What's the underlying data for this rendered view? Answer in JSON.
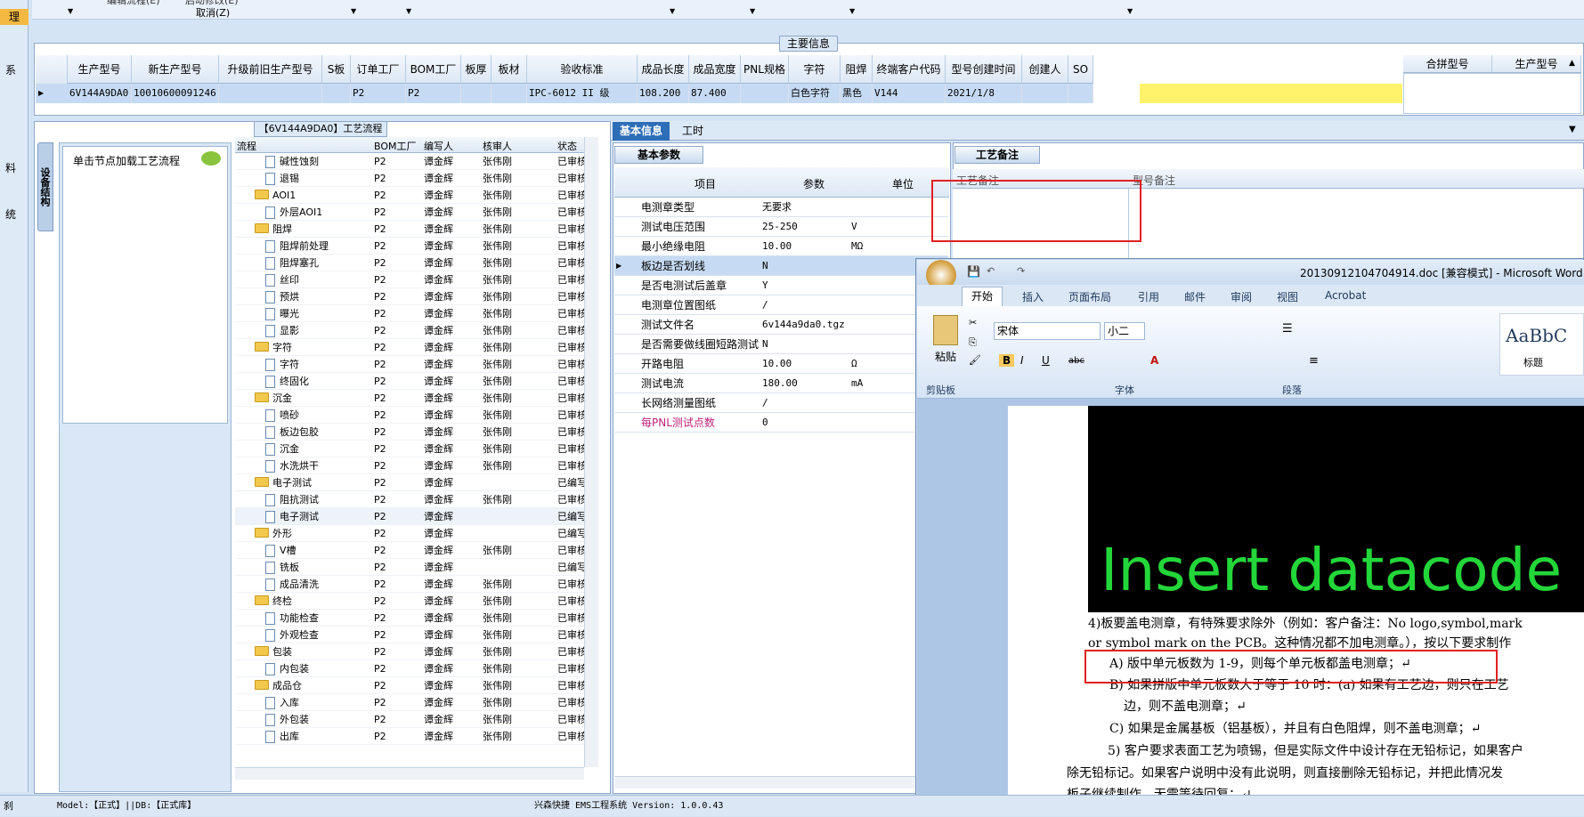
{
  "topbar": {
    "item1": "编辑流程(E)",
    "item2": "启动修改(E)",
    "cancel": "取消(Z)",
    "left_sel": "理"
  },
  "left_strip": {
    "chars": [
      "系",
      "料",
      "统"
    ]
  },
  "main_info": {
    "legend": "主要信息",
    "columns": [
      "生产型号",
      "新生产型号",
      "升级前旧生产型号",
      "S板",
      "订单工厂",
      "BOM工厂",
      "板厚",
      "板材",
      "验收标准",
      "成品长度",
      "成品宽度",
      "PNL规格",
      "字符",
      "阻焊",
      "终端客户代码",
      "型号创建时间",
      "创建人",
      "SO"
    ],
    "row": [
      "6V144A9DA0",
      "10010600091246",
      "",
      "",
      "P2",
      "P2",
      "",
      "",
      "IPC-6012 II 级",
      "108.200",
      "87.400",
      "",
      "白色字符",
      "黑色",
      "V144",
      "2021/1/8",
      "",
      ""
    ],
    "right_columns": [
      "合拼型号",
      "生产型号"
    ]
  },
  "process": {
    "title": "【6V144A9DA0】工艺流程",
    "side_tab": "设备结构",
    "click_hint": "单击节点加载工艺流程",
    "columns": [
      "流程",
      "BOM工厂",
      "编写人",
      "核审人",
      "状态"
    ],
    "rows": [
      {
        "level": 2,
        "type": "doc",
        "name": "碱性蚀刻",
        "bom": "P2",
        "writer": "谭金辉",
        "reviewer": "张伟刚",
        "status": "已审核"
      },
      {
        "level": 2,
        "type": "doc",
        "name": "退锡",
        "bom": "P2",
        "writer": "谭金辉",
        "reviewer": "张伟刚",
        "status": "已审核"
      },
      {
        "level": 1,
        "type": "folder",
        "name": "AOI1",
        "bom": "P2",
        "writer": "谭金辉",
        "reviewer": "张伟刚",
        "status": "已审核"
      },
      {
        "level": 2,
        "type": "doc",
        "name": "外层AOI1",
        "bom": "P2",
        "writer": "谭金辉",
        "reviewer": "张伟刚",
        "status": "已审核"
      },
      {
        "level": 1,
        "type": "folder",
        "name": "阻焊",
        "bom": "P2",
        "writer": "谭金辉",
        "reviewer": "张伟刚",
        "status": "已审核"
      },
      {
        "level": 2,
        "type": "doc",
        "name": "阻焊前处理",
        "bom": "P2",
        "writer": "谭金辉",
        "reviewer": "张伟刚",
        "status": "已审核"
      },
      {
        "level": 2,
        "type": "doc",
        "name": "阻焊塞孔",
        "bom": "P2",
        "writer": "谭金辉",
        "reviewer": "张伟刚",
        "status": "已审核"
      },
      {
        "level": 2,
        "type": "doc",
        "name": "丝印",
        "bom": "P2",
        "writer": "谭金辉",
        "reviewer": "张伟刚",
        "status": "已审核"
      },
      {
        "level": 2,
        "type": "doc",
        "name": "预烘",
        "bom": "P2",
        "writer": "谭金辉",
        "reviewer": "张伟刚",
        "status": "已审核"
      },
      {
        "level": 2,
        "type": "doc",
        "name": "曝光",
        "bom": "P2",
        "writer": "谭金辉",
        "reviewer": "张伟刚",
        "status": "已审核"
      },
      {
        "level": 2,
        "type": "doc",
        "name": "显影",
        "bom": "P2",
        "writer": "谭金辉",
        "reviewer": "张伟刚",
        "status": "已审核"
      },
      {
        "level": 1,
        "type": "folder",
        "name": "字符",
        "bom": "P2",
        "writer": "谭金辉",
        "reviewer": "张伟刚",
        "status": "已审核"
      },
      {
        "level": 2,
        "type": "doc",
        "name": "字符",
        "bom": "P2",
        "writer": "谭金辉",
        "reviewer": "张伟刚",
        "status": "已审核"
      },
      {
        "level": 2,
        "type": "doc",
        "name": "终固化",
        "bom": "P2",
        "writer": "谭金辉",
        "reviewer": "张伟刚",
        "status": "已审核"
      },
      {
        "level": 1,
        "type": "folder",
        "name": "沉金",
        "bom": "P2",
        "writer": "谭金辉",
        "reviewer": "张伟刚",
        "status": "已审核"
      },
      {
        "level": 2,
        "type": "doc",
        "name": "喷砂",
        "bom": "P2",
        "writer": "谭金辉",
        "reviewer": "张伟刚",
        "status": "已审核"
      },
      {
        "level": 2,
        "type": "doc",
        "name": "板边包胶",
        "bom": "P2",
        "writer": "谭金辉",
        "reviewer": "张伟刚",
        "status": "已审核"
      },
      {
        "level": 2,
        "type": "doc",
        "name": "沉金",
        "bom": "P2",
        "writer": "谭金辉",
        "reviewer": "张伟刚",
        "status": "已审核"
      },
      {
        "level": 2,
        "type": "doc",
        "name": "水洗烘干",
        "bom": "P2",
        "writer": "谭金辉",
        "reviewer": "张伟刚",
        "status": "已审核"
      },
      {
        "level": 1,
        "type": "folder",
        "name": "电子测试",
        "bom": "P2",
        "writer": "谭金辉",
        "reviewer": "",
        "status": "已编写"
      },
      {
        "level": 2,
        "type": "doc",
        "name": "阻抗测试",
        "bom": "P2",
        "writer": "谭金辉",
        "reviewer": "张伟刚",
        "status": "已审核"
      },
      {
        "level": 2,
        "type": "doc",
        "name": "电子测试",
        "bom": "P2",
        "writer": "谭金辉",
        "reviewer": "",
        "status": "已编写",
        "selected": true
      },
      {
        "level": 1,
        "type": "folder",
        "name": "外形",
        "bom": "P2",
        "writer": "谭金辉",
        "reviewer": "",
        "status": "已编写"
      },
      {
        "level": 2,
        "type": "doc",
        "name": "V槽",
        "bom": "P2",
        "writer": "谭金辉",
        "reviewer": "张伟刚",
        "status": "已审核"
      },
      {
        "level": 2,
        "type": "doc",
        "name": "铣板",
        "bom": "P2",
        "writer": "谭金辉",
        "reviewer": "",
        "status": "已编写"
      },
      {
        "level": 2,
        "type": "doc",
        "name": "成品清洗",
        "bom": "P2",
        "writer": "谭金辉",
        "reviewer": "张伟刚",
        "status": "已审核"
      },
      {
        "level": 1,
        "type": "folder",
        "name": "终检",
        "bom": "P2",
        "writer": "谭金辉",
        "reviewer": "张伟刚",
        "status": "已审核"
      },
      {
        "level": 2,
        "type": "doc",
        "name": "功能检查",
        "bom": "P2",
        "writer": "谭金辉",
        "reviewer": "张伟刚",
        "status": "已审核"
      },
      {
        "level": 2,
        "type": "doc",
        "name": "外观检查",
        "bom": "P2",
        "writer": "谭金辉",
        "reviewer": "张伟刚",
        "status": "已审核"
      },
      {
        "level": 1,
        "type": "folder",
        "name": "包装",
        "bom": "P2",
        "writer": "谭金辉",
        "reviewer": "张伟刚",
        "status": "已审核"
      },
      {
        "level": 2,
        "type": "doc",
        "name": "内包装",
        "bom": "P2",
        "writer": "谭金辉",
        "reviewer": "张伟刚",
        "status": "已审核"
      },
      {
        "level": 1,
        "type": "folder",
        "name": "成品仓",
        "bom": "P2",
        "writer": "谭金辉",
        "reviewer": "张伟刚",
        "status": "已审核"
      },
      {
        "level": 2,
        "type": "doc",
        "name": "入库",
        "bom": "P2",
        "writer": "谭金辉",
        "reviewer": "张伟刚",
        "status": "已审核"
      },
      {
        "level": 2,
        "type": "doc",
        "name": "外包装",
        "bom": "P2",
        "writer": "谭金辉",
        "reviewer": "张伟刚",
        "status": "已审核"
      },
      {
        "level": 2,
        "type": "doc",
        "name": "出库",
        "bom": "P2",
        "writer": "谭金辉",
        "reviewer": "张伟刚",
        "status": "已审核"
      }
    ]
  },
  "params": {
    "tabs": [
      "基本信息",
      "工时"
    ],
    "sub_tab": "基本参数",
    "columns": [
      "项目",
      "参数",
      "单位"
    ],
    "rows": [
      {
        "item": "电测章类型",
        "value": "无要求",
        "unit": ""
      },
      {
        "item": "测试电压范围",
        "value": "25-250",
        "unit": "V"
      },
      {
        "item": "最小绝缘电阻",
        "value": "10.00",
        "unit": "MΩ"
      },
      {
        "item": "板边是否划线",
        "value": "N",
        "unit": "",
        "current": true
      },
      {
        "item": "是否电测试后盖章",
        "value": "Y",
        "unit": ""
      },
      {
        "item": "电测章位置图纸",
        "value": "/",
        "unit": ""
      },
      {
        "item": "测试文件名",
        "value": "6v144a9da0.tgz",
        "unit": ""
      },
      {
        "item": "是否需要做线圈短路测试",
        "value": "N",
        "unit": ""
      },
      {
        "item": "开路电阻",
        "value": "10.00",
        "unit": "Ω"
      },
      {
        "item": "测试电流",
        "value": "180.00",
        "unit": "mA"
      },
      {
        "item": "长网络测量图纸",
        "value": "/",
        "unit": ""
      },
      {
        "item": "每PNL测试点数",
        "value": "0",
        "unit": "",
        "highlight": true
      }
    ]
  },
  "remarks": {
    "tab": "工艺备注",
    "col1": "工艺备注",
    "col2": "型号备注"
  },
  "word": {
    "title": "20130912104704914.doc [兼容模式] - Microsoft Word",
    "tabs": [
      "开始",
      "插入",
      "页面布局",
      "引用",
      "邮件",
      "审阅",
      "视图",
      "Acrobat"
    ],
    "font_name": "宋体",
    "font_size": "小二",
    "groups": {
      "clipboard": "剪贴板",
      "font": "字体",
      "paragraph": "段落"
    },
    "paste": "粘贴",
    "style_preview": "AaBbC",
    "style_name": "标题",
    "image_text": "Insert datacode",
    "paragraphs": [
      "4)板要盖电测章，有特殊要求除外（例如：客户备注：No logo,symbol,mark",
      "or symbol mark on the PCB。这种情况都不加电测章。），按以下要求制作",
      "A) 版中单元板数为 1-9，则每个单元板都盖电测章；↵",
      "B) 如果拼版中单元板数大于等于 10 时：(a) 如果有工艺边，则只在工艺",
      "边，则不盖电测章；↵",
      "C) 如果是金属基板（铝基板），并且有白色阻焊，则不盖电测章；↵",
      "5) 客户要求表面工艺为喷锡，但是实际文件中设计存在无铅标记，如果客户",
      "除无铅标记。如果客户说明中没有此说明，则直接删除无铅标记，并把此情况发",
      "板子继续制作，无需等待回复；↵"
    ]
  },
  "status": {
    "left": "刹",
    "model": "Model:【正式】||DB:【正式库】",
    "system": "兴森快捷 EMS工程系统 Version: 1.0.0.43"
  },
  "colors": {
    "accent": "#1e5aa8",
    "selection": "#c6dbf3",
    "highlight_yellow": "#fff36b",
    "red_box": "#e02020",
    "green_text": "#23d639"
  }
}
